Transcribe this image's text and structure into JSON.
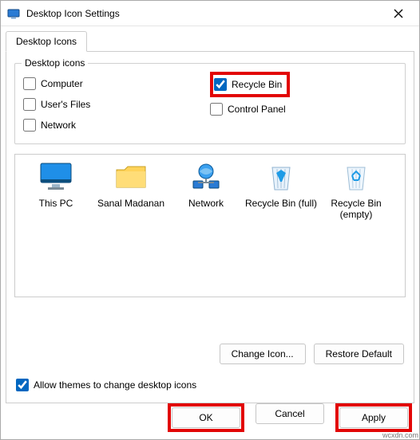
{
  "window": {
    "title": "Desktop Icon Settings"
  },
  "tabs": {
    "tab1": "Desktop Icons"
  },
  "group": {
    "label": "Desktop icons",
    "items": {
      "computer": "Computer",
      "recycle": "Recycle Bin",
      "userfiles": "User's Files",
      "control": "Control Panel",
      "network": "Network"
    }
  },
  "icons": {
    "thispc": "This PC",
    "user": "Sanal Madanan",
    "network": "Network",
    "bin_full": "Recycle Bin (full)",
    "bin_empty": "Recycle Bin (empty)"
  },
  "buttons": {
    "change_icon": "Change Icon...",
    "restore_default": "Restore Default",
    "ok": "OK",
    "cancel": "Cancel",
    "apply": "Apply"
  },
  "allow_themes": "Allow themes to change desktop icons",
  "watermark": "wcxdn.com"
}
